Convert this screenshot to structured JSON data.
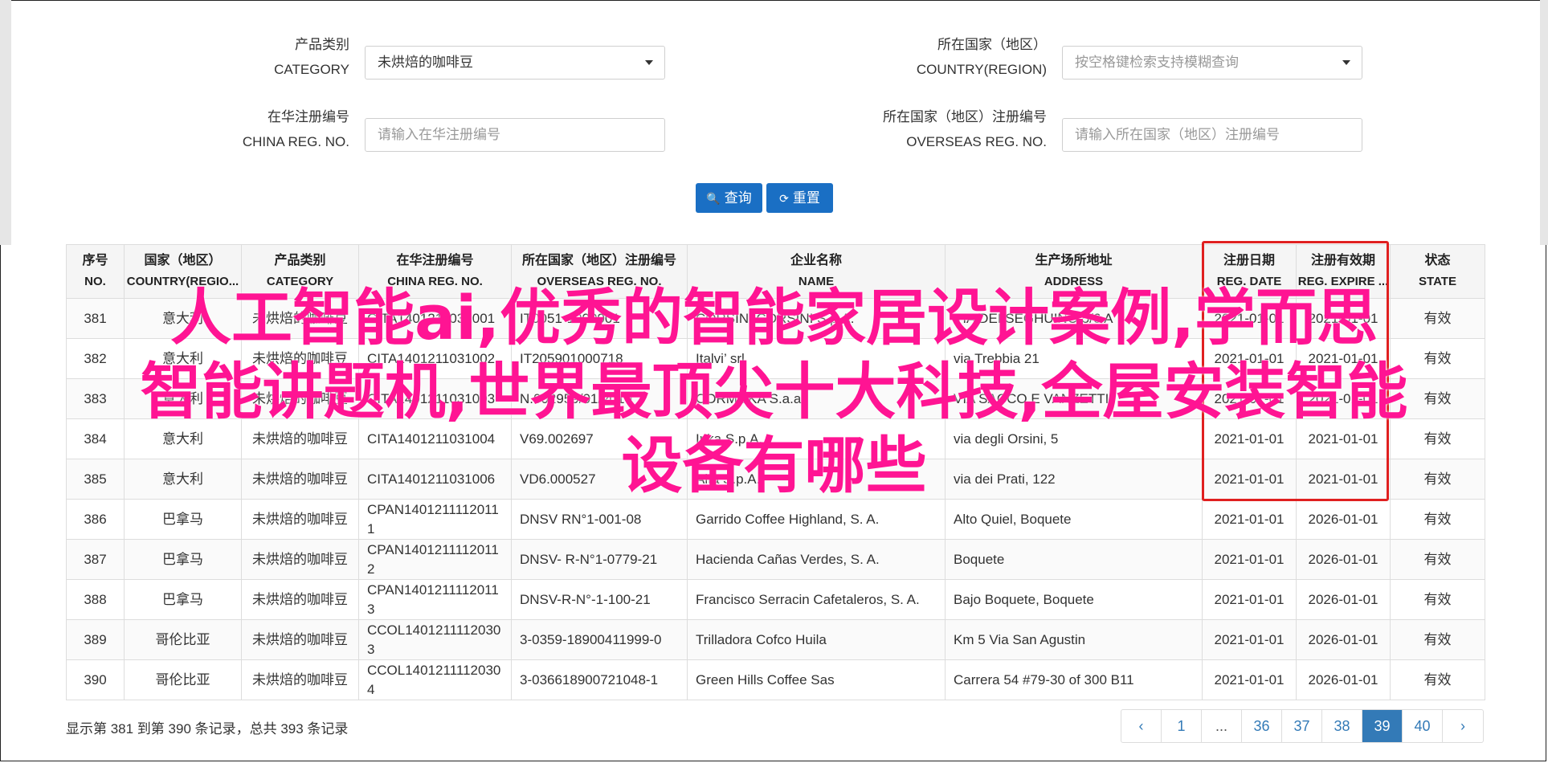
{
  "filters": {
    "category": {
      "label_cn": "产品类别",
      "label_en": "CATEGORY",
      "value": "未烘焙的咖啡豆"
    },
    "country": {
      "label_cn": "所在国家（地区）",
      "label_en": "COUNTRY(REGION)",
      "placeholder": "按空格键检索支持模糊查询"
    },
    "china_reg": {
      "label_cn": "在华注册编号",
      "label_en": "CHINA REG. NO.",
      "placeholder": "请输入在华注册编号"
    },
    "overseas_reg": {
      "label_cn": "所在国家（地区）注册编号",
      "label_en": "OVERSEAS REG. NO.",
      "placeholder": "请输入所在国家（地区）注册编号"
    }
  },
  "buttons": {
    "search": "查询",
    "reset": "重置"
  },
  "table": {
    "headers": [
      {
        "cn": "序号",
        "en": "NO."
      },
      {
        "cn": "国家（地区）",
        "en": "COUNTRY(REGIO..."
      },
      {
        "cn": "产品类别",
        "en": "CATEGORY"
      },
      {
        "cn": "在华注册编号",
        "en": "CHINA REG. NO."
      },
      {
        "cn": "所在国家（地区）注册编号",
        "en": "OVERSEAS REG. NO."
      },
      {
        "cn": "企业名称",
        "en": "NAME"
      },
      {
        "cn": "生产场所地址",
        "en": "ADDRESS"
      },
      {
        "cn": "注册日期",
        "en": "REG. DATE"
      },
      {
        "cn": "注册有效期",
        "en": "REG. EXPIRE ..."
      },
      {
        "cn": "状态",
        "en": "STATE"
      }
    ],
    "rows": [
      {
        "no": "381",
        "country": "意大利",
        "category": "未烘焙的咖啡豆",
        "china_reg": "CITA1401211031001",
        "overseas_reg": "IT0051-1000001",
        "name": "CORSINI CORSINI S.p.A.",
        "address": "VIA DEI SEGHUINO 5/6 A",
        "reg_date": "2021-01-01",
        "expire": "2021-01-01",
        "state": "有效"
      },
      {
        "no": "382",
        "country": "意大利",
        "category": "未烘焙的咖啡豆",
        "china_reg": "CITA1401211031002",
        "overseas_reg": "IT205901000718",
        "name": "Italvi’ srl",
        "address": "via Trebbia 21",
        "reg_date": "2021-01-01",
        "expire": "2021-01-01",
        "state": "有效"
      },
      {
        "no": "383",
        "country": "意大利",
        "category": "未烘焙的咖啡豆",
        "china_reg": "CITA1401211031003",
        "overseas_reg": "N.002959/01/2010",
        "name": "CORMOKA S.a.a.",
        "address": "VIA SACCO E VANZETTI",
        "reg_date": "2021-01-01",
        "expire": "2021-01-01",
        "state": "有效"
      },
      {
        "no": "384",
        "country": "意大利",
        "category": "未烘焙的咖啡豆",
        "china_reg": "CITA1401211031004",
        "overseas_reg": "V69.002697",
        "name": "Inka S.p.A.",
        "address": "via degli Orsini, 5",
        "reg_date": "2021-01-01",
        "expire": "2021-01-01",
        "state": "有效"
      },
      {
        "no": "385",
        "country": "意大利",
        "category": "未烘焙的咖啡豆",
        "china_reg": "CITA1401211031006",
        "overseas_reg": "VD6.000527",
        "name": "Alfa S.p.A.",
        "address": "via dei Prati, 122",
        "reg_date": "2021-01-01",
        "expire": "2021-01-01",
        "state": "有效"
      },
      {
        "no": "386",
        "country": "巴拿马",
        "category": "未烘焙的咖啡豆",
        "china_reg": "CPAN14012111120111",
        "overseas_reg": "DNSV RN°1-001-08",
        "name": "Garrido Coffee Highland, S. A.",
        "address": "Alto Quiel, Boquete",
        "reg_date": "2021-01-01",
        "expire": "2026-01-01",
        "state": "有效"
      },
      {
        "no": "387",
        "country": "巴拿马",
        "category": "未烘焙的咖啡豆",
        "china_reg": "CPAN14012111120112",
        "overseas_reg": "DNSV- R-N°1-0779-21",
        "name": "Hacienda Cañas Verdes, S. A.",
        "address": "Boquete",
        "reg_date": "2021-01-01",
        "expire": "2026-01-01",
        "state": "有效"
      },
      {
        "no": "388",
        "country": "巴拿马",
        "category": "未烘焙的咖啡豆",
        "china_reg": "CPAN14012111120113",
        "overseas_reg": "DNSV-R-N°-1-100-21",
        "name": "Francisco Serracin Cafetaleros, S. A.",
        "address": "Bajo Boquete, Boquete",
        "reg_date": "2021-01-01",
        "expire": "2026-01-01",
        "state": "有效"
      },
      {
        "no": "389",
        "country": "哥伦比亚",
        "category": "未烘焙的咖啡豆",
        "china_reg": "CCOL14012111120303",
        "overseas_reg": "3-0359-18900411999-0",
        "name": "Trilladora Cofco Huila",
        "address": "Km 5 Via San Agustin",
        "reg_date": "2021-01-01",
        "expire": "2026-01-01",
        "state": "有效"
      },
      {
        "no": "390",
        "country": "哥伦比亚",
        "category": "未烘焙的咖啡豆",
        "china_reg": "CCOL14012111120304",
        "overseas_reg": "3-036618900721048-1",
        "name": "Green Hills Coffee Sas",
        "address": "Carrera 54 #79-30 of 300 B11",
        "reg_date": "2021-01-01",
        "expire": "2026-01-01",
        "state": "有效"
      }
    ]
  },
  "summary": "显示第 381 到第 390 条记录，总共 393 条记录",
  "pagination": {
    "prev": "‹",
    "pages": [
      "1",
      "...",
      "36",
      "37",
      "38",
      "39",
      "40"
    ],
    "active": "39",
    "next": "›"
  },
  "overlay": {
    "line1": "人工智能ai,优秀的智能家居设计案例,学而思",
    "line2": "智能讲题机,世界最顶尖十大科技,全屋安装智能",
    "line3": "设备有哪些",
    "color": "#ff1493"
  },
  "colors": {
    "primary": "#1a6fc4",
    "highlight": "#e02020"
  }
}
